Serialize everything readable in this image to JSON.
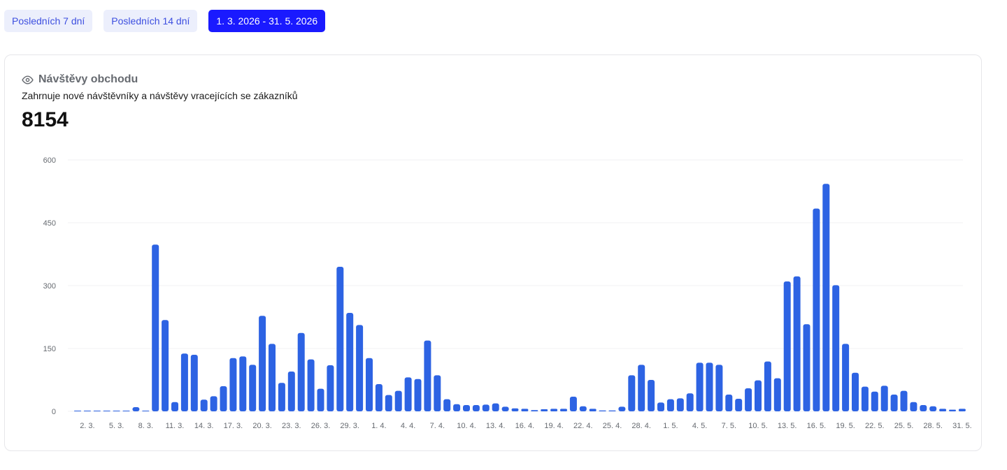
{
  "filters": {
    "last7_label": "Posledních 7 dní",
    "last14_label": "Posledních 14 dní",
    "custom_range_label": "1. 3. 2026 - 31. 5. 2026"
  },
  "card": {
    "icon": "eye-icon",
    "title": "Návštěvy obchodu",
    "subtitle": "Zahrnuje nové návštěvníky a návštěvy vracejících se zákazníků",
    "total": "8154"
  },
  "colors": {
    "bar": "#2d63e3",
    "active_filter": "#1a1aff",
    "filter_bg": "#eceffc",
    "filter_text": "#3d4fe0"
  },
  "chart_data": {
    "type": "bar",
    "title": "",
    "xlabel": "",
    "ylabel": "",
    "ylim": [
      0,
      600
    ],
    "y_ticks": [
      "0",
      "150",
      "300",
      "450",
      "600"
    ],
    "grid": true,
    "x_tick_labels": [
      "2. 3.",
      "5. 3.",
      "8. 3.",
      "11. 3.",
      "14. 3.",
      "17. 3.",
      "20. 3.",
      "23. 3.",
      "26. 3.",
      "29. 3.",
      "1. 4.",
      "4. 4.",
      "7. 4.",
      "10. 4.",
      "13. 4.",
      "16. 4.",
      "19. 4.",
      "22. 4.",
      "25. 4.",
      "28. 4.",
      "1. 5.",
      "4. 5.",
      "7. 5.",
      "10. 5.",
      "13. 5.",
      "16. 5.",
      "19. 5.",
      "22. 5.",
      "25. 5.",
      "28. 5.",
      "31. 5."
    ],
    "categories": [
      "1. 3.",
      "2. 3.",
      "3. 3.",
      "4. 3.",
      "5. 3.",
      "6. 3.",
      "7. 3.",
      "8. 3.",
      "9. 3.",
      "10. 3.",
      "11. 3.",
      "12. 3.",
      "13. 3.",
      "14. 3.",
      "15. 3.",
      "16. 3.",
      "17. 3.",
      "18. 3.",
      "19. 3.",
      "20. 3.",
      "21. 3.",
      "22. 3.",
      "23. 3.",
      "24. 3.",
      "25. 3.",
      "26. 3.",
      "27. 3.",
      "28. 3.",
      "29. 3.",
      "30. 3.",
      "31. 3.",
      "1. 4.",
      "2. 4.",
      "3. 4.",
      "4. 4.",
      "5. 4.",
      "6. 4.",
      "7. 4.",
      "8. 4.",
      "9. 4.",
      "10. 4.",
      "11. 4.",
      "12. 4.",
      "13. 4.",
      "14. 4.",
      "15. 4.",
      "16. 4.",
      "17. 4.",
      "18. 4.",
      "19. 4.",
      "20. 4.",
      "21. 4.",
      "22. 4.",
      "23. 4.",
      "24. 4.",
      "25. 4.",
      "26. 4.",
      "27. 4.",
      "28. 4.",
      "29. 4.",
      "30. 4.",
      "1. 5.",
      "2. 5.",
      "3. 5.",
      "4. 5.",
      "5. 5.",
      "6. 5.",
      "7. 5.",
      "8. 5.",
      "9. 5.",
      "10. 5.",
      "11. 5.",
      "12. 5.",
      "13. 5.",
      "14. 5.",
      "15. 5.",
      "16. 5.",
      "17. 5.",
      "18. 5.",
      "19. 5.",
      "20. 5.",
      "21. 5.",
      "22. 5.",
      "23. 5.",
      "24. 5.",
      "25. 5.",
      "26. 5.",
      "27. 5.",
      "28. 5.",
      "29. 5.",
      "30. 5.",
      "31. 5."
    ],
    "values": [
      0,
      0,
      0,
      0,
      0,
      0,
      10,
      1,
      398,
      218,
      22,
      138,
      135,
      28,
      36,
      60,
      127,
      131,
      111,
      228,
      161,
      68,
      95,
      187,
      124,
      54,
      110,
      345,
      235,
      206,
      127,
      65,
      39,
      49,
      81,
      77,
      169,
      86,
      29,
      17,
      15,
      15,
      16,
      19,
      11,
      7,
      6,
      3,
      5,
      6,
      6,
      35,
      12,
      6,
      2,
      2,
      11,
      86,
      111,
      75,
      21,
      29,
      31,
      43,
      116,
      116,
      111,
      40,
      30,
      55,
      74,
      119,
      79,
      310,
      322,
      208,
      484,
      543,
      301,
      161,
      92,
      59,
      47,
      61,
      40,
      49,
      22,
      15,
      12,
      6,
      4,
      6
    ]
  }
}
